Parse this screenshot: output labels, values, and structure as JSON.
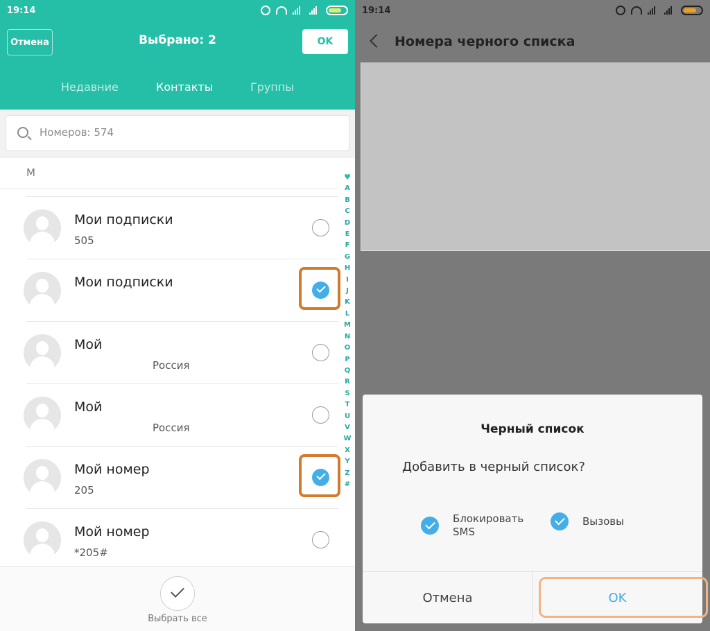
{
  "left": {
    "status": {
      "time": "19:14"
    },
    "header": {
      "cancel": "Отмена",
      "title": "Выбрано: 2",
      "ok": "OK"
    },
    "tabs": [
      "Недавние",
      "Контакты",
      "Группы"
    ],
    "search": {
      "placeholder": "Номеров: 574"
    },
    "section": "M",
    "contacts": [
      {
        "name": "Мои подписки",
        "sub": "505",
        "checked": false
      },
      {
        "name": "Мои подписки",
        "sub": "",
        "checked": true
      },
      {
        "name": "Мой",
        "sub": "Россия",
        "checked": false
      },
      {
        "name": "Мой",
        "sub": "Россия",
        "checked": false
      },
      {
        "name": "Мой номер",
        "sub": "205",
        "checked": true
      },
      {
        "name": "Мой номер",
        "sub": "*205#",
        "checked": false
      }
    ],
    "alphabet": [
      "A",
      "B",
      "C",
      "D",
      "E",
      "F",
      "G",
      "H",
      "I",
      "J",
      "K",
      "L",
      "M",
      "N",
      "O",
      "P",
      "Q",
      "R",
      "S",
      "T",
      "U",
      "V",
      "W",
      "X",
      "Y",
      "Z",
      "#"
    ],
    "select_all": "Выбрать все",
    "colors": {
      "accent": "#25bfa8",
      "check": "#43aee7",
      "highlight": "#d37b2c"
    }
  },
  "right": {
    "status": {
      "time": "19:14"
    },
    "header": {
      "title": "Номера черного списка"
    },
    "dialog": {
      "title": "Черный список",
      "question": "Добавить в черный список?",
      "options": [
        "Блокировать SMS",
        "Вызовы"
      ],
      "cancel": "Отмена",
      "ok": "OK"
    },
    "colors": {
      "check": "#43aee7",
      "ok_highlight": "#f2b485"
    }
  }
}
